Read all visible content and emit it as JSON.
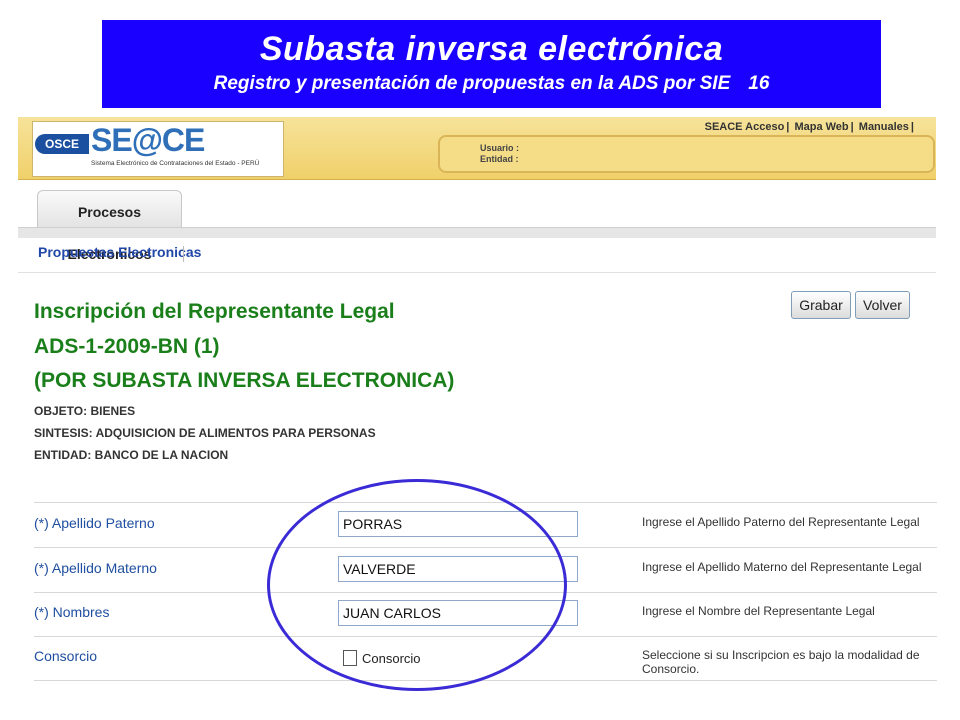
{
  "slide": {
    "title": "Subasta inversa electrónica",
    "subtitle": "Registro y presentación de propuestas en la ADS por SIE",
    "page_number": "16"
  },
  "header": {
    "osce_badge": "OSCE",
    "logo_text": "SE@CE",
    "logo_subtitle": "Sistema Electrónico de Contrataciones del Estado - PERÚ",
    "top_links": [
      "SEACE Acceso",
      "Mapa Web",
      "Manuales"
    ],
    "user_label": "Usuario :",
    "entity_label": "Entidad :"
  },
  "tabs": [
    {
      "label": "Procesos Electronicos"
    }
  ],
  "subnav": {
    "label": "Propuestas Electronicas"
  },
  "actions": {
    "grabar": "Grabar",
    "volver": "Volver"
  },
  "page": {
    "heading": "Inscripción del Representante Legal",
    "process_id": "ADS-1-2009-BN (1)",
    "process_type": "(POR SUBASTA INVERSA ELECTRONICA)",
    "objeto": "OBJETO: BIENES",
    "sintesis": "SINTESIS: ADQUISICION DE ALIMENTOS PARA PERSONAS",
    "entidad": "ENTIDAD: BANCO DE LA NACION"
  },
  "form": {
    "apellido_paterno": {
      "label": "(*) Apellido Paterno",
      "value": "PORRAS",
      "help": "Ingrese el Apellido Paterno del Representante Legal"
    },
    "apellido_materno": {
      "label": "(*) Apellido Materno",
      "value": "VALVERDE",
      "help": "Ingrese el Apellido Materno del Representante Legal"
    },
    "nombres": {
      "label": "(*) Nombres",
      "value": "JUAN CARLOS",
      "help": "Ingrese el Nombre del Representante Legal"
    },
    "consorcio": {
      "label": "Consorcio",
      "checkbox_label": "Consorcio",
      "checked": false,
      "help": "Seleccione si su Inscripcion es bajo la modalidad de Consorcio."
    }
  },
  "colors": {
    "banner": "#1a00ff",
    "title_green": "#1a7f1a",
    "link_blue": "#1f4fa0",
    "highlight": "#3a2bd6"
  }
}
